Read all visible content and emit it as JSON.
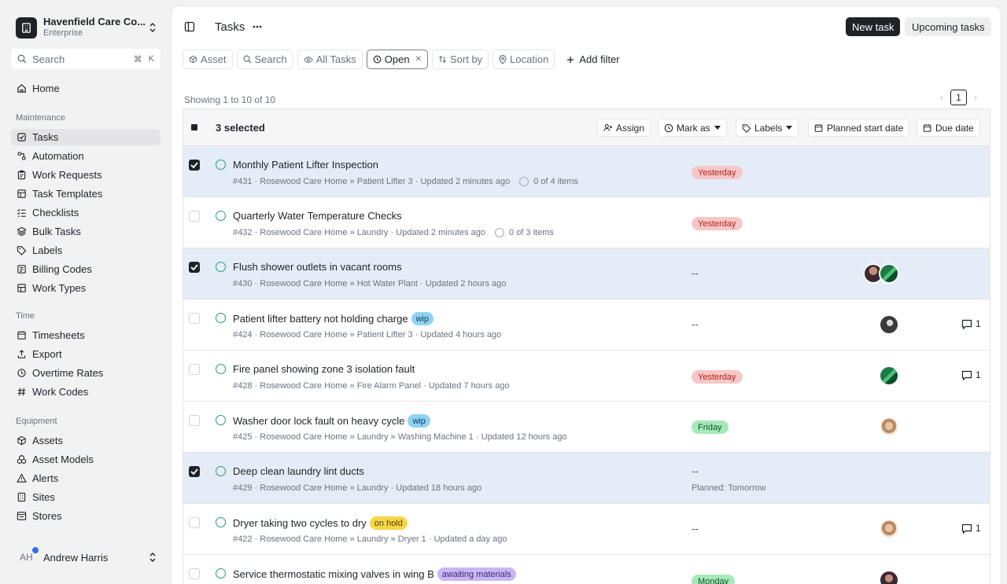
{
  "org": {
    "name": "Havenfield Care Co...",
    "plan": "Enterprise"
  },
  "search": {
    "label": "Search",
    "shortcut_mod": "⌘",
    "shortcut_key": "K"
  },
  "nav": {
    "home": "Home",
    "maintenance_title": "Maintenance",
    "maintenance": [
      "Tasks",
      "Automation",
      "Work Requests",
      "Task Templates",
      "Checklists",
      "Bulk Tasks",
      "Labels",
      "Billing Codes",
      "Work Types"
    ],
    "time_title": "Time",
    "time": [
      "Timesheets",
      "Export",
      "Overtime Rates",
      "Work Codes"
    ],
    "equipment_title": "Equipment",
    "equipment": [
      "Assets",
      "Asset Models",
      "Alerts",
      "Sites",
      "Stores"
    ]
  },
  "user": {
    "initials": "AH",
    "name": "Andrew Harris"
  },
  "header": {
    "title": "Tasks",
    "new_task": "New task",
    "upcoming": "Upcoming tasks"
  },
  "filters": {
    "asset": "Asset",
    "search": "Search",
    "all_tasks": "All Tasks",
    "open": "Open",
    "sort_by": "Sort by",
    "location": "Location",
    "add_filter": "Add filter"
  },
  "showing": "Showing 1 to 10 of 10",
  "pager": {
    "page": "1"
  },
  "toolbar": {
    "selected": "3 selected",
    "assign": "Assign",
    "mark_as": "Mark as",
    "labels": "Labels",
    "planned_start": "Planned start date",
    "due_date": "Due date"
  },
  "colors": {
    "accent": "#1f2328",
    "status_open": "#22a06b",
    "selected_row": "#e4ecf7",
    "badge_yesterday": "#f7c6c6",
    "badge_green": "#a7e9b8",
    "tag_wip": "#8fd3f4",
    "tag_hold": "#f7d64a",
    "tag_awaiting": "#c9b6f4"
  },
  "rows": [
    {
      "title": "Monthly Patient Lifter Inspection",
      "meta": "#431 · Rosewood Care Home » Patient Lifter 3 · Updated 2 minutes ago",
      "items": "0 of 4 items",
      "due": "Yesterday"
    },
    {
      "title": "Quarterly Water Temperature Checks",
      "meta": "#432 · Rosewood Care Home » Laundry · Updated 2 minutes ago",
      "items": "0 of 3 items",
      "due": "Yesterday"
    },
    {
      "title": "Flush shower outlets in vacant rooms",
      "meta": "#430 · Rosewood Care Home » Hot Water Plant · Updated 2 hours ago",
      "due": "--"
    },
    {
      "title": "Patient lifter battery not holding charge",
      "tag": "wip",
      "meta": "#424 · Rosewood Care Home » Patient Lifter 3 · Updated 4 hours ago",
      "due": "--",
      "comments": "1"
    },
    {
      "title": "Fire panel showing zone 3 isolation fault",
      "meta": "#428 · Rosewood Care Home » Fire Alarm Panel · Updated 7 hours ago",
      "due": "Yesterday",
      "comments": "1"
    },
    {
      "title": "Washer door lock fault on heavy cycle",
      "tag": "wip",
      "meta": "#425 · Rosewood Care Home » Laundry » Washing Machine 1 · Updated 12 hours ago",
      "due": "Friday"
    },
    {
      "title": "Deep clean laundry lint ducts",
      "meta": "#429 · Rosewood Care Home » Laundry · Updated 18 hours ago",
      "due": "--",
      "planned": "Planned: Tomorrow"
    },
    {
      "title": "Dryer taking two cycles to dry",
      "tag": "on hold",
      "meta": "#422 · Rosewood Care Home » Laundry » Dryer 1 · Updated a day ago",
      "due": "--",
      "comments": "1"
    },
    {
      "title": "Service thermostatic mixing valves in wing B",
      "tag": "awaiting materials",
      "due": "Monday"
    }
  ]
}
